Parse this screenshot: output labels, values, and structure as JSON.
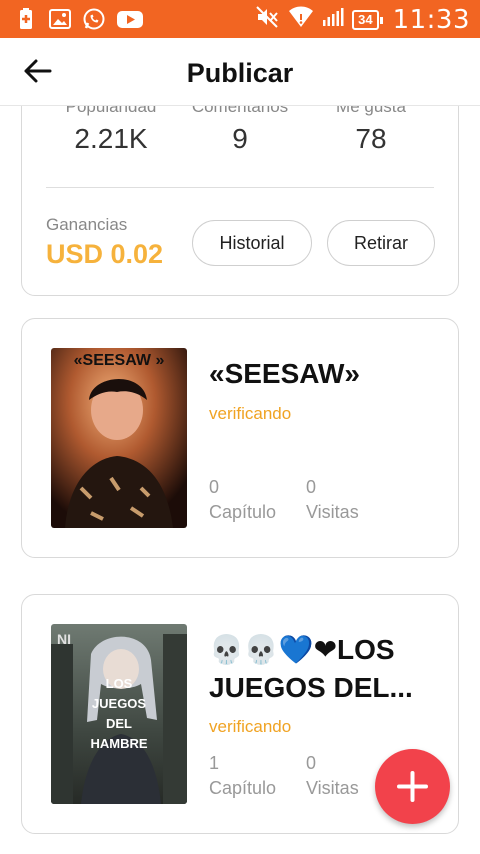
{
  "status_bar": {
    "time": "11:33",
    "battery": "34",
    "left_icons": [
      "battery-saver-icon",
      "gallery-icon",
      "whatsapp-icon",
      "youtube-icon"
    ],
    "right_icons": [
      "mute-icon",
      "wifi-icon",
      "signal-icon"
    ]
  },
  "header": {
    "title": "Publicar",
    "back_icon": "arrow-left-icon"
  },
  "stats": {
    "items": [
      {
        "label": "Popularidad",
        "value": "2.21K"
      },
      {
        "label": "Comentarios",
        "value": "9"
      },
      {
        "label": "Me gusta",
        "value": "78"
      }
    ],
    "earnings_label": "Ganancias",
    "earnings_value": "USD 0.02",
    "history_button": "Historial",
    "withdraw_button": "Retirar"
  },
  "books": [
    {
      "title": "«SEESAW»",
      "cover_text": "«SEESAW »",
      "status": "verificando",
      "chapters": "0",
      "chapters_label": "Capítulo",
      "visits": "0",
      "visits_label": "Visitas"
    },
    {
      "title": "💀💀💙❤LOS JUEGOS DEL...",
      "cover_text": "LOS JUEGOS DEL HAMBRE",
      "status": "verificando",
      "chapters": "1",
      "chapters_label": "Capítulo",
      "visits": "0",
      "visits_label": "Visitas"
    }
  ],
  "fab": {
    "icon": "plus-icon"
  },
  "colors": {
    "status_bar": "#f26522",
    "earnings": "#f6b23c",
    "status_text": "#f0a323",
    "fab": "#f2424b"
  }
}
